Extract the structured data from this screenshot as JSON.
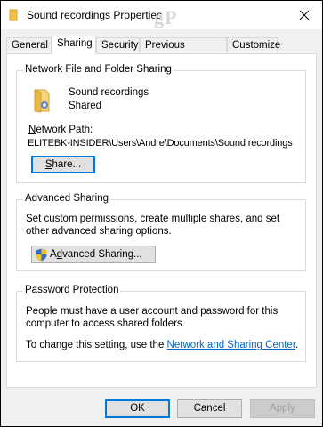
{
  "window": {
    "title": "Sound recordings Properties",
    "watermark": "gP"
  },
  "tabs": [
    {
      "label": "General"
    },
    {
      "label": "Sharing"
    },
    {
      "label": "Security"
    },
    {
      "label": "Previous Versions"
    },
    {
      "label": "Customize"
    }
  ],
  "network_sharing": {
    "group_label": "Network File and Folder Sharing",
    "folder_name": "Sound recordings",
    "status": "Shared",
    "path_label_first": "N",
    "path_label_rest": "etwork Path:",
    "path_value": "ELITEBK-INSIDER\\Users\\Andre\\Documents\\Sound recordings",
    "share_button_first": "S",
    "share_button_rest": "hare..."
  },
  "advanced_sharing": {
    "group_label": "Advanced Sharing",
    "description": "Set custom permissions, create multiple shares, and set other advanced sharing options.",
    "button_pre": "A",
    "button_underline": "d",
    "button_post": "vanced Sharing..."
  },
  "password": {
    "group_label": "Password Protection",
    "description": "People must have a user account and password for this computer to access shared folders.",
    "change_text": "To change this setting, use the ",
    "link_text": "Network and Sharing Center",
    "change_suffix": "."
  },
  "footer": {
    "ok": "OK",
    "cancel": "Cancel",
    "apply": "Apply"
  },
  "icons": {
    "folder": "folder-icon",
    "shared_folder": "shared-folder-icon",
    "shield": "uac-shield-icon",
    "close": "close-icon"
  }
}
